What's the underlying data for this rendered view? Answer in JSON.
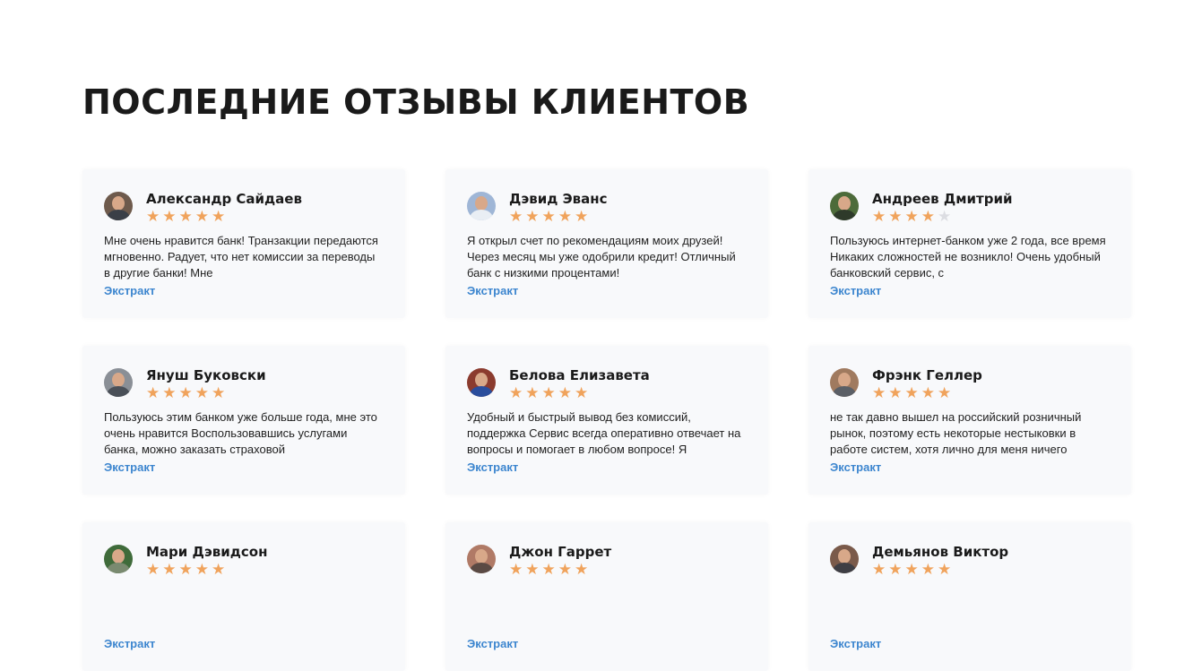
{
  "section": {
    "title": "ПОСЛЕДНИЕ ОТЗЫВЫ КЛИЕНТОВ"
  },
  "more_label": "Экстракт",
  "colors": {
    "star": "#f0a35c",
    "star_off": "#dcdde2",
    "link": "#3d86cf",
    "card_bg": "#f8f9fb"
  },
  "reviews": [
    {
      "name": "Александр Сайдаев",
      "rating": 5,
      "text": "Мне очень нравится банк! Транзакции передаются мгновенно. Радует, что нет комиссии за переводы в другие банки! Мне"
    },
    {
      "name": "Дэвид Эванс",
      "rating": 5,
      "text": "Я открыл счет по рекомендациям моих друзей! Через месяц мы уже одобрили кредит! Отличный банк с низкими процентами!"
    },
    {
      "name": "Андреев Дмитрий",
      "rating": 4,
      "text": "Пользуюсь интернет-банком уже 2 года, все время Никаких сложностей не возникло! Очень удобный банковский сервис, с"
    },
    {
      "name": "Януш Буковски",
      "rating": 5,
      "text": "Пользуюсь этим банком уже больше года, мне это очень нравится Воспользовавшись услугами банка, можно заказать страховой"
    },
    {
      "name": "Белова Елизавета",
      "rating": 5,
      "text": "Удобный и быстрый вывод без комиссий, поддержка Сервис всегда оперативно отвечает на вопросы и помогает в любом вопросе! Я"
    },
    {
      "name": "Фрэнк Геллер",
      "rating": 5,
      "text": "не так давно вышел на российский розничный рынок, поэтому есть некоторые нестыковки в работе систем, хотя лично для меня ничего"
    },
    {
      "name": "Мари Дэвидсон",
      "rating": 5,
      "text": ""
    },
    {
      "name": "Джон Гаррет",
      "rating": 5,
      "text": ""
    },
    {
      "name": "Демьянов Виктор",
      "rating": 5,
      "text": ""
    }
  ]
}
